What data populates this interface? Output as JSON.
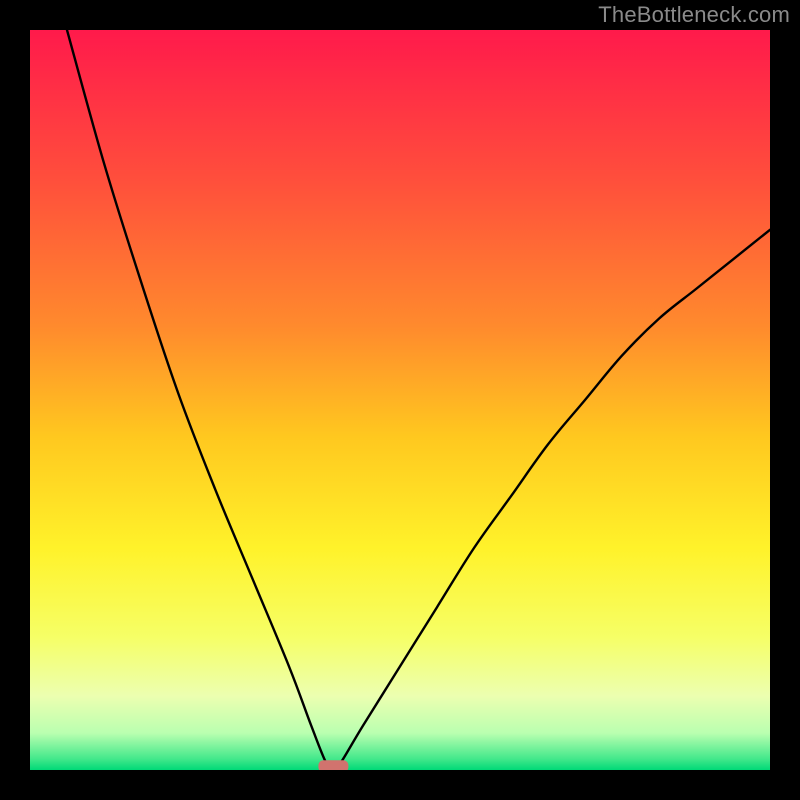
{
  "watermark": "TheBottleneck.com",
  "chart_data": {
    "type": "line",
    "title": "",
    "xlabel": "",
    "ylabel": "",
    "xlim": [
      0,
      100
    ],
    "ylim": [
      0,
      100
    ],
    "grid": false,
    "series": [
      {
        "name": "bottleneck-curve",
        "x": [
          0,
          5,
          10,
          15,
          20,
          25,
          30,
          35,
          38,
          40,
          41,
          42,
          45,
          50,
          55,
          60,
          65,
          70,
          75,
          80,
          85,
          90,
          95,
          100
        ],
        "y": [
          null,
          100,
          82,
          66,
          51,
          38,
          26,
          14,
          6,
          1,
          0,
          1,
          6,
          14,
          22,
          30,
          37,
          44,
          50,
          56,
          61,
          65,
          69,
          73
        ]
      }
    ],
    "background_gradient": {
      "type": "vertical",
      "stops": [
        {
          "pos": 0.0,
          "color": "#ff1a4b"
        },
        {
          "pos": 0.2,
          "color": "#ff4e3c"
        },
        {
          "pos": 0.4,
          "color": "#ff8a2d"
        },
        {
          "pos": 0.55,
          "color": "#ffc81f"
        },
        {
          "pos": 0.7,
          "color": "#fff22a"
        },
        {
          "pos": 0.82,
          "color": "#f6ff66"
        },
        {
          "pos": 0.9,
          "color": "#ecffb0"
        },
        {
          "pos": 0.95,
          "color": "#baffb0"
        },
        {
          "pos": 0.985,
          "color": "#43e88b"
        },
        {
          "pos": 1.0,
          "color": "#00d977"
        }
      ]
    },
    "marker": {
      "x": 41,
      "y": 0.5,
      "color": "#d1736e",
      "shape": "rounded-rect"
    }
  }
}
